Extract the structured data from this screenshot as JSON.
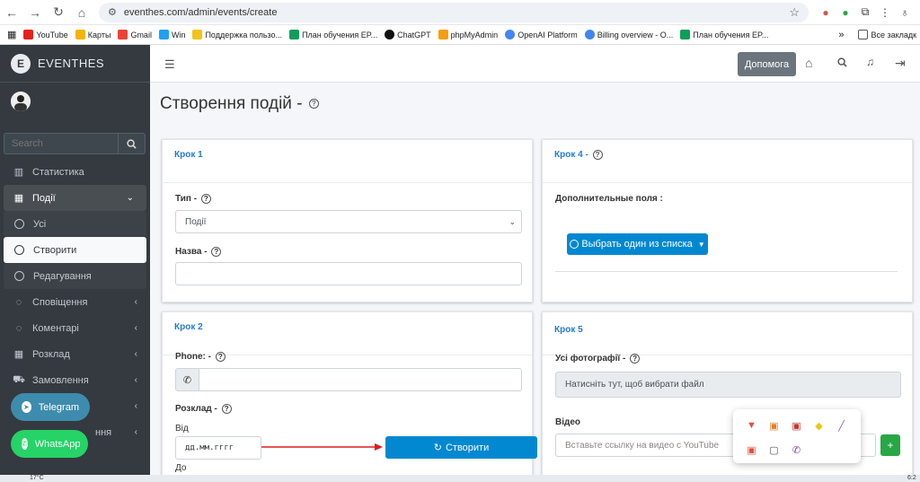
{
  "browser": {
    "url": "eventhes.com/admin/events/create",
    "bookmarks": [
      "YouTube",
      "Карты",
      "Gmail",
      "Win",
      "Поддержка пользо...",
      "План обучения EP...",
      "ChatGPT",
      "phpMyAdmin",
      "OpenAI Platform",
      "Billing overview - O...",
      "План обучения EP..."
    ],
    "all_bookmarks": "Все закладк"
  },
  "sidebar": {
    "brand": "EVENTHES",
    "brand_letter": "E",
    "search_placeholder": "Search",
    "items": [
      {
        "label": "Статистика",
        "icon": "chart-icon"
      },
      {
        "label": "Події",
        "icon": "calendar-icon"
      },
      {
        "label": "Усі",
        "icon": "circle-icon"
      },
      {
        "label": "Створити",
        "icon": "circle-icon"
      },
      {
        "label": "Редагування",
        "icon": "circle-icon"
      },
      {
        "label": "Сповіщення",
        "icon": "chat-icon"
      },
      {
        "label": "Коментарі",
        "icon": "comments-icon"
      },
      {
        "label": "Розклад",
        "icon": "calendar-icon"
      },
      {
        "label": "Замовлення",
        "icon": "cart-icon"
      }
    ],
    "partial_item": "ння",
    "telegram": "Telegram",
    "whatsapp": "WhatsApp"
  },
  "topnav": {
    "help": "Допомога"
  },
  "page": {
    "title": "Створення подій -",
    "step1": {
      "title": "Крок 1",
      "type_label": "Тип -",
      "type_value": "Події",
      "name_label": "Назва -"
    },
    "step4": {
      "title": "Крок 4 -",
      "extra_fields": "Дополнительные поля :",
      "choose_button": "Выбрать один из списка"
    },
    "step2": {
      "title": "Крок 2",
      "phone_label": "Phone: -",
      "schedule_label": "Розклад -",
      "from_label": "Від",
      "date_placeholder": "дд.мм.гггг",
      "to_label": "До"
    },
    "step5": {
      "title": "Крок 5",
      "photos_label": "Усі фотографії -",
      "photos_button": "Натисніть тут, щоб вибрати файл",
      "video_label": "Відео",
      "video_placeholder": "Вставьте ссылку на видео с YouTube"
    },
    "create_button": "Створити"
  },
  "taskbar": {
    "temperature": "17°C",
    "time": "6:2"
  },
  "colors": {
    "sidebar": "#343a40",
    "accent": "#0288d1",
    "link": "#1f7ad8",
    "telegram": "#3d8cad",
    "whatsapp": "#25d366",
    "plus": "#28a745"
  }
}
